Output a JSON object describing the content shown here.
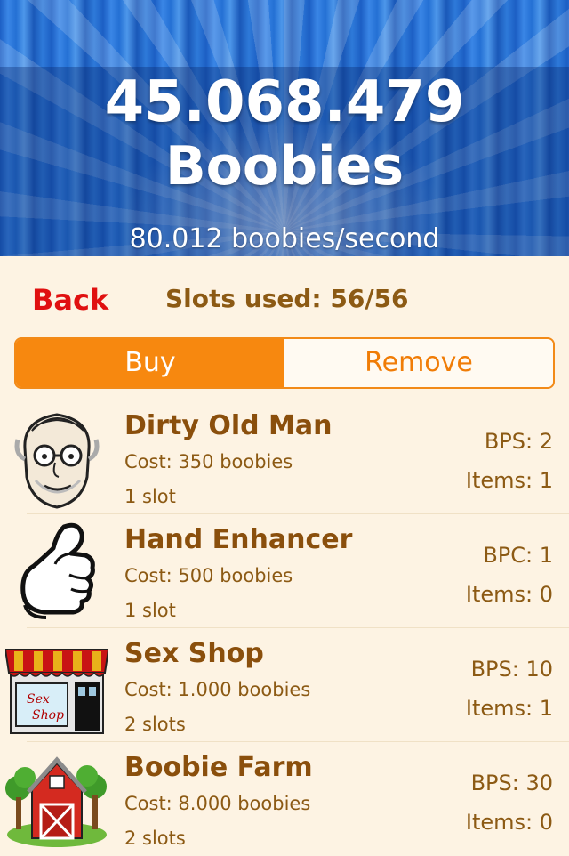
{
  "header": {
    "score": "45.068.479",
    "unit": "Boobies",
    "rate": "80.012 boobies/second"
  },
  "controls": {
    "back_label": "Back",
    "slots_used": "Slots used: 56/56"
  },
  "tabs": [
    {
      "label": "Buy",
      "selected": true
    },
    {
      "label": "Remove",
      "selected": false
    }
  ],
  "items": [
    {
      "icon": "old-man-icon",
      "name": "Dirty Old Man",
      "cost": "Cost: 350 boobies",
      "slots": "1 slot",
      "rate": "BPS: 2",
      "items": "Items: 1"
    },
    {
      "icon": "hand-icon",
      "name": "Hand Enhancer",
      "cost": "Cost: 500 boobies",
      "slots": "1 slot",
      "rate": "BPC: 1",
      "items": "Items: 0"
    },
    {
      "icon": "shop-icon",
      "name": "Sex Shop",
      "cost": "Cost: 1.000 boobies",
      "slots": "2 slots",
      "rate": "BPS: 10",
      "items": "Items: 1",
      "icon_text": "Sex Shop"
    },
    {
      "icon": "barn-icon",
      "name": "Boobie Farm",
      "cost": "Cost: 8.000 boobies",
      "slots": "2 slots",
      "rate": "BPS: 30",
      "items": "Items: 0"
    }
  ],
  "colors": {
    "accent": "#f7880f",
    "back": "#e01010",
    "text": "#8c5a14",
    "background": "#fdf3e3"
  }
}
